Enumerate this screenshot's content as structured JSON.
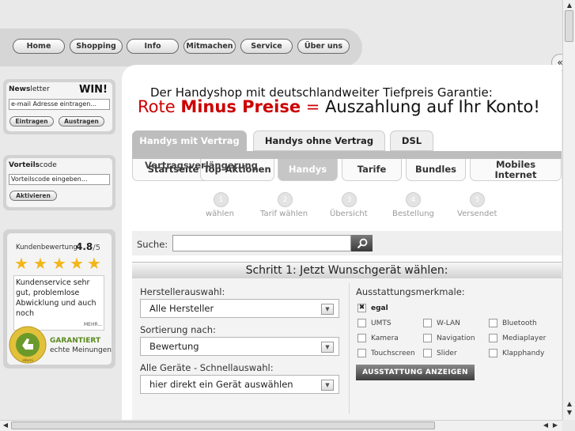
{
  "nav": {
    "items": [
      {
        "label": "Home"
      },
      {
        "label": "Shopping"
      },
      {
        "label": "Info"
      },
      {
        "label": "Mitmachen"
      },
      {
        "label": "Service"
      },
      {
        "label": "Über uns"
      }
    ]
  },
  "header": {
    "line1": "Der Handyshop mit deutschlandweiter Tiefpreis Garantie:",
    "line2_part1": "Rote ",
    "line2_part2": "Minus Preise",
    "line2_part3": " = ",
    "line2_part4": "Auszahlung auf Ihr Konto!"
  },
  "tabs": [
    {
      "label": "Handys mit Vertrag",
      "active": true
    },
    {
      "label": "Handys ohne Vertrag"
    },
    {
      "label": "DSL"
    }
  ],
  "subtabs": {
    "overlap_label": "Vertragsverlängerung",
    "items": [
      {
        "label": "Startseite"
      },
      {
        "label": "Top-Aktionen"
      },
      {
        "label": "Handys",
        "active": true
      },
      {
        "label": "Tarife"
      },
      {
        "label": "Bundles"
      },
      {
        "label": "Mobiles Internet"
      }
    ]
  },
  "steps": [
    {
      "num": "1",
      "label": "wählen"
    },
    {
      "num": "2",
      "label": "Tarif wählen"
    },
    {
      "num": "3",
      "label": "Übersicht"
    },
    {
      "num": "4",
      "label": "Bestellung"
    },
    {
      "num": "5",
      "label": "Versendet"
    }
  ],
  "search": {
    "label": "Suche:",
    "value": ""
  },
  "step_title": "Schritt 1: Jetzt Wunschgerät wählen:",
  "filters": {
    "manufacturer_label": "Herstellerauswahl:",
    "manufacturer_value": "Alle Hersteller",
    "sort_label": "Sortierung nach:",
    "sort_value": "Bewertung",
    "quick_label": "Alle Geräte - Schnellauswahl:",
    "quick_value": "hier direkt ein Gerät auswählen"
  },
  "features": {
    "label": "Ausstattungsmerkmale:",
    "egal": "egal",
    "items": [
      "UMTS",
      "W-LAN",
      "Bluetooth",
      "Kamera",
      "Navigation",
      "Mediaplayer",
      "Touchscreen",
      "Slider",
      "Klapphandy"
    ],
    "button": "AUSSTATTUNG ANZEIGEN"
  },
  "newsletter": {
    "title_bold": "News",
    "title_rest": "letter",
    "win": "WIN!",
    "placeholder": "e-mail Adresse eintragen...",
    "subscribe": "Eintragen",
    "unsubscribe": "Austragen"
  },
  "voucher": {
    "title_bold": "Vorteils",
    "title_rest": "code",
    "placeholder": "Vorteilscode eingeben...",
    "activate": "Aktivieren"
  },
  "rating": {
    "label": "Kundenbewertung",
    "score": "4.8",
    "max": "/5",
    "review": "Kundenservice sehr gut, problemlose Abwicklung und auch noch",
    "more": "MEHR...",
    "guarantee": "GARANTIERT",
    "real": "echte Meinungen",
    "seal_text": "KUNDENAUSZEICHNUNG",
    "seal_brand": "eKomi"
  },
  "colors": {
    "accent_red": "#cc0000",
    "tab_active": "#bdbdbd",
    "seal_green": "#6c9a2a"
  }
}
